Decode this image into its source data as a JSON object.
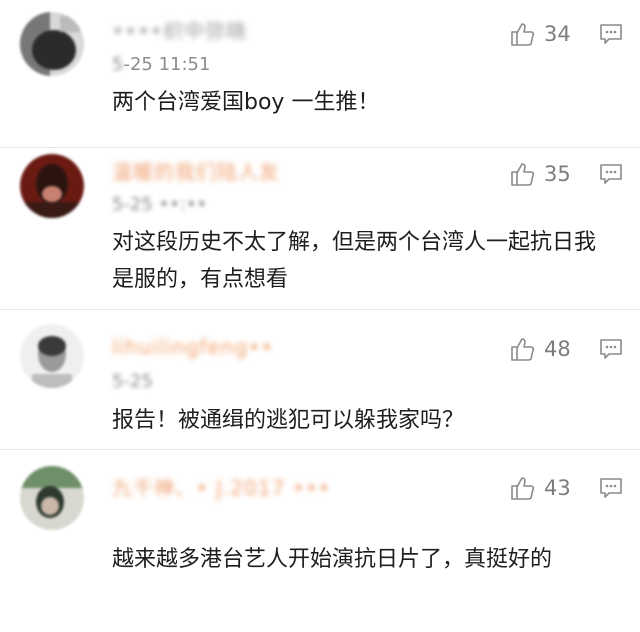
{
  "comments": [
    {
      "username": "••••织中弥晓",
      "time_blur": "5",
      "time_clear": "-25 11:51",
      "text": "两个台湾爱国boy 一生推！",
      "likes": "34",
      "name_color": "#9b9b9b",
      "avatar_colors": [
        "#2b2b2b",
        "#d9d9d9",
        "#777777"
      ]
    },
    {
      "username": "温暖的我们陆人友",
      "time_blur": "5-25 ••:••",
      "time_clear": "",
      "text": "对这段历史不太了解，但是两个台湾人一起抗日我是服的，有点想看",
      "likes": "35",
      "name_color": "#f0a070",
      "avatar_colors": [
        "#6b1a12",
        "#2b1410",
        "#c88070"
      ]
    },
    {
      "username": "lihuilingfeng••",
      "time_blur": "5-25",
      "time_clear": "",
      "text": "报告！被通缉的逃犯可以躲我家吗？",
      "likes": "48",
      "name_color": "#f2a26a",
      "avatar_colors": [
        "#efefef",
        "#3a3a3a",
        "#9a9a9a"
      ]
    },
    {
      "username": "九千神、• J.2017 •••",
      "time_blur": "",
      "time_clear": "",
      "text": "越来越多港台艺人开始演抗日片了，真挺好的",
      "likes": "43",
      "name_color": "#f0a070",
      "avatar_colors": [
        "#6f8f6a",
        "#2f3a2f",
        "#d8d8d0"
      ]
    }
  ],
  "icons": {
    "like": "thumbs-up-icon",
    "reply": "comment-icon"
  },
  "colors": {
    "divider": "#e6e6e6",
    "meta_gray": "#8c8c8c",
    "count_gray": "#7d7d7d"
  }
}
